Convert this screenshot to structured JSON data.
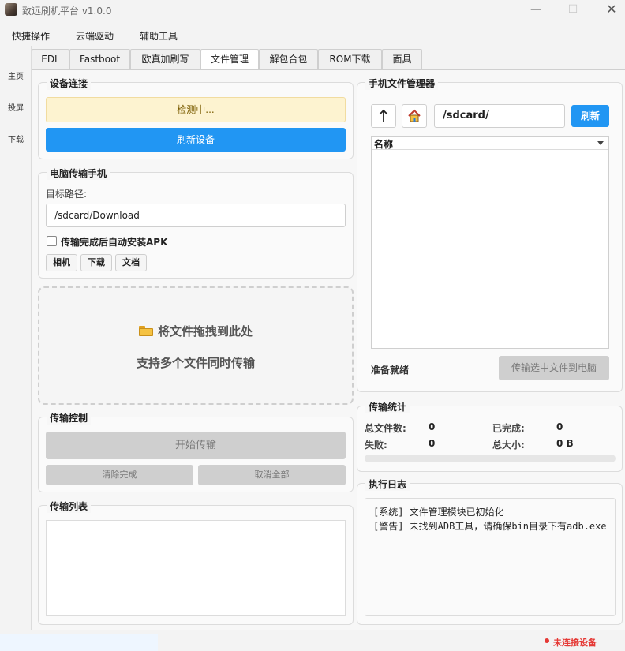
{
  "window": {
    "title": "致远刷机平台 v1.0.0",
    "minimize": "—",
    "maximize": "☐",
    "close": "✕"
  },
  "menu": {
    "items": [
      "快捷操作",
      "云端驱动",
      "辅助工具"
    ]
  },
  "sidebar": {
    "items": [
      "主页",
      "投屏",
      "下载"
    ]
  },
  "tabs": {
    "items": [
      "EDL",
      "Fastboot",
      "欧真加刷写",
      "文件管理",
      "解包合包",
      "ROM下载",
      "面具"
    ],
    "active": "文件管理"
  },
  "device": {
    "title": "设备连接",
    "status": "检测中...",
    "refresh_label": "刷新设备"
  },
  "pc_to_phone": {
    "title": "电脑传输手机",
    "path_label": "目标路径:",
    "path_value": "/sdcard/Download",
    "auto_install_label": "传输完成后自动安装APK",
    "shortcuts": [
      "相机",
      "下载",
      "文档"
    ]
  },
  "drop_zone": {
    "icon": "folder-icon",
    "line1": "将文件拖拽到此处",
    "line2": "支持多个文件同时传输"
  },
  "transfer_control": {
    "title": "传输控制",
    "start_label": "开始传输",
    "clear_label": "清除完成",
    "cancel_label": "取消全部"
  },
  "transfer_list": {
    "title": "传输列表"
  },
  "phone_fm": {
    "title": "手机文件管理器",
    "up_icon": "up-arrow-icon",
    "home_icon": "home-icon",
    "path_value": "/sdcard/",
    "refresh_label": "刷新",
    "column_name": "名称",
    "status": "准备就绪",
    "transfer_label": "传输选中文件到电脑"
  },
  "stats": {
    "title": "传输统计",
    "total_label": "总文件数:",
    "total_value": "0",
    "done_label": "已完成:",
    "done_value": "0",
    "failed_label": "失败:",
    "failed_value": "0",
    "size_label": "总大小:",
    "size_value": "0 B",
    "progress": 0
  },
  "log": {
    "title": "执行日志",
    "lines": [
      "[系统] 文件管理模块已初始化",
      "[警告] 未找到ADB工具，请确保bin目录下有adb.exe"
    ]
  },
  "statusbar": {
    "connection": "未连接设备"
  },
  "colors": {
    "accent": "#2196f3",
    "warning_bg": "#fdf3d0",
    "error": "#e53935"
  }
}
